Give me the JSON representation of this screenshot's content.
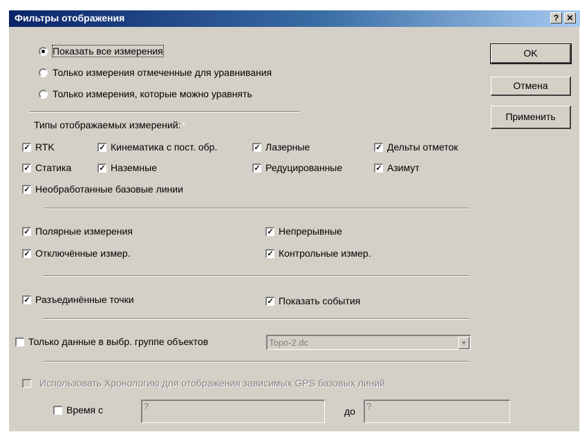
{
  "window": {
    "title": "Фильтры отображения",
    "help_glyph": "?",
    "close_glyph": "✕"
  },
  "buttons": {
    "ok": "OK",
    "cancel": "Отмена",
    "apply": "Применить"
  },
  "display_mode": {
    "options": [
      {
        "label": "Показать все измерения",
        "selected": true
      },
      {
        "label": "Только измерения отмеченные для уравнивания",
        "selected": false
      },
      {
        "label": "Только измерения, которые можно уравнять",
        "selected": false
      }
    ]
  },
  "types": {
    "heading": "Типы отображаемых измерений:",
    "rtk": "RTK",
    "kinematic": "Кинематика с пост. обр.",
    "laser": "Лазерные",
    "height_deltas": "Дельты отметок",
    "static": "Статика",
    "ground": "Наземные",
    "reduced": "Редуцированные",
    "azimuth": "Азимут",
    "raw_baselines": "Необработанные базовые линии"
  },
  "more": {
    "polar": "Полярные измерения",
    "continuous": "Непрерывные",
    "disabled_obs": "Отключённые измер.",
    "control_obs": "Контрольные измер.",
    "disconnected_points": "Разъединённые точки",
    "show_events": "Показать события"
  },
  "group_filter": {
    "label": "Только данные в выбр. группе объектов",
    "selected": "Topo-2.dc"
  },
  "chronology": {
    "label": "Использовать Хронологию для отображения зависимых GPS базовых линий",
    "time_from_label": "Время с",
    "time_from_value": "?",
    "to_label": "до",
    "time_to_value": "?"
  },
  "icons": {
    "check": "✓",
    "dropdown": "▼"
  }
}
